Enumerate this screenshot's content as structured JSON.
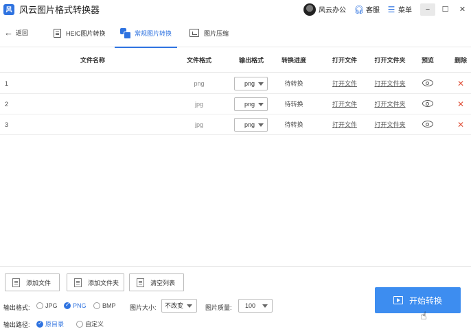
{
  "app": {
    "title": "风云图片格式转换器",
    "logo_text": "风"
  },
  "titlebar": {
    "brand": "风云办公",
    "service": "客服",
    "menu": "菜单",
    "minimize": "−",
    "maximize": "☐",
    "close": "✕"
  },
  "nav": {
    "back_label": "返回",
    "tabs": [
      {
        "label": "HEIC图片转换",
        "active": false
      },
      {
        "label": "常规图片转换",
        "active": true
      },
      {
        "label": "图片压缩",
        "active": false
      }
    ]
  },
  "table": {
    "headers": [
      "文件名称",
      "文件格式",
      "输出格式",
      "转换进度",
      "打开文件",
      "打开文件夹",
      "预览",
      "删除"
    ],
    "rows": [
      {
        "index": "1",
        "format": "png",
        "output": "png",
        "progress": "待转换",
        "open_file": "打开文件",
        "open_folder": "打开文件夹"
      },
      {
        "index": "2",
        "format": "jpg",
        "output": "png",
        "progress": "待转换",
        "open_file": "打开文件",
        "open_folder": "打开文件夹"
      },
      {
        "index": "3",
        "format": "jpg",
        "output": "png",
        "progress": "待转换",
        "open_file": "打开文件",
        "open_folder": "打开文件夹"
      }
    ]
  },
  "bottom": {
    "add_file": "添加文件",
    "add_folder": "添加文件夹",
    "clear_list": "清空列表",
    "output_format_label": "输出格式:",
    "formats": [
      {
        "label": "JPG",
        "checked": false
      },
      {
        "label": "PNG",
        "checked": true
      },
      {
        "label": "BMP",
        "checked": false
      }
    ],
    "size_label": "图片大小:",
    "size_value": "不改变",
    "quality_label": "图片质量:",
    "quality_value": "100",
    "path_label": "输出路径:",
    "paths": [
      {
        "label": "原目录",
        "checked": true
      },
      {
        "label": "自定义",
        "checked": false
      }
    ],
    "start_button": "开始转换"
  },
  "colors": {
    "accent": "#2f73e0",
    "start_button": "#3d8df0",
    "delete": "#e0533c"
  }
}
